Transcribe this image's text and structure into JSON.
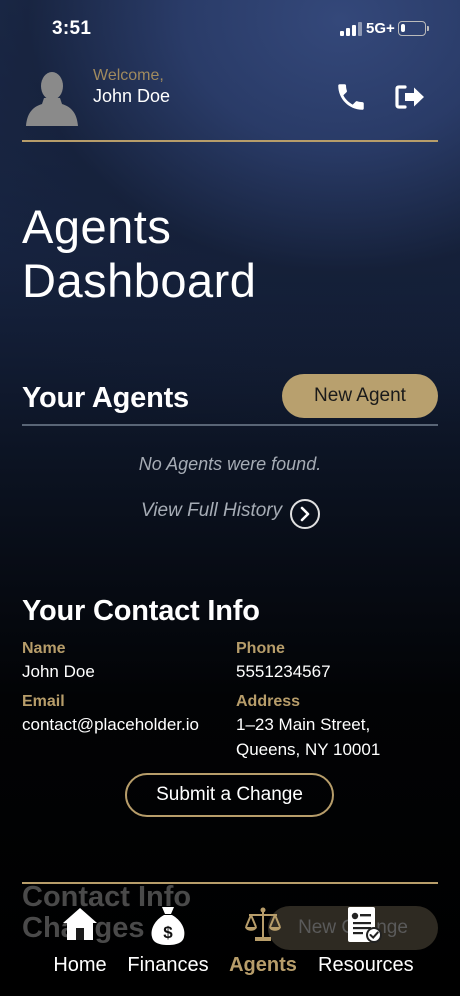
{
  "status_bar": {
    "time": "3:51",
    "network": "5G+",
    "battery_level": 0.2
  },
  "header": {
    "welcome": "Welcome,",
    "user_name": "John Doe",
    "icons": [
      "avatar",
      "phone-icon",
      "logout-icon"
    ]
  },
  "page": {
    "title": "Agents Dashboard"
  },
  "agents": {
    "title": "Your Agents",
    "new_button": "New Agent",
    "empty_message": "No Agents were found.",
    "history_link": "View Full History"
  },
  "contact": {
    "title": "Your Contact Info",
    "name_label": "Name",
    "name_value": "John Doe",
    "phone_label": "Phone",
    "phone_value": "5551234567",
    "email_label": "Email",
    "email_value": "contact@placeholder.io",
    "address_label": "Address",
    "address_value": "1–23 Main Street, Queens, NY 10001",
    "submit_button": "Submit a Change"
  },
  "changes": {
    "title": "Contact Info Changes",
    "new_button": "New Change"
  },
  "tabs": [
    {
      "label": "Home",
      "icon": "home-icon",
      "active": false
    },
    {
      "label": "Finances",
      "icon": "money-bag-icon",
      "active": false
    },
    {
      "label": "Agents",
      "icon": "scales-icon",
      "active": true
    },
    {
      "label": "Resources",
      "icon": "document-icon",
      "active": false
    }
  ],
  "colors": {
    "accent_gold": "#b79d6a",
    "button_gold": "#b8a06e",
    "muted_text": "#a6acb5"
  }
}
